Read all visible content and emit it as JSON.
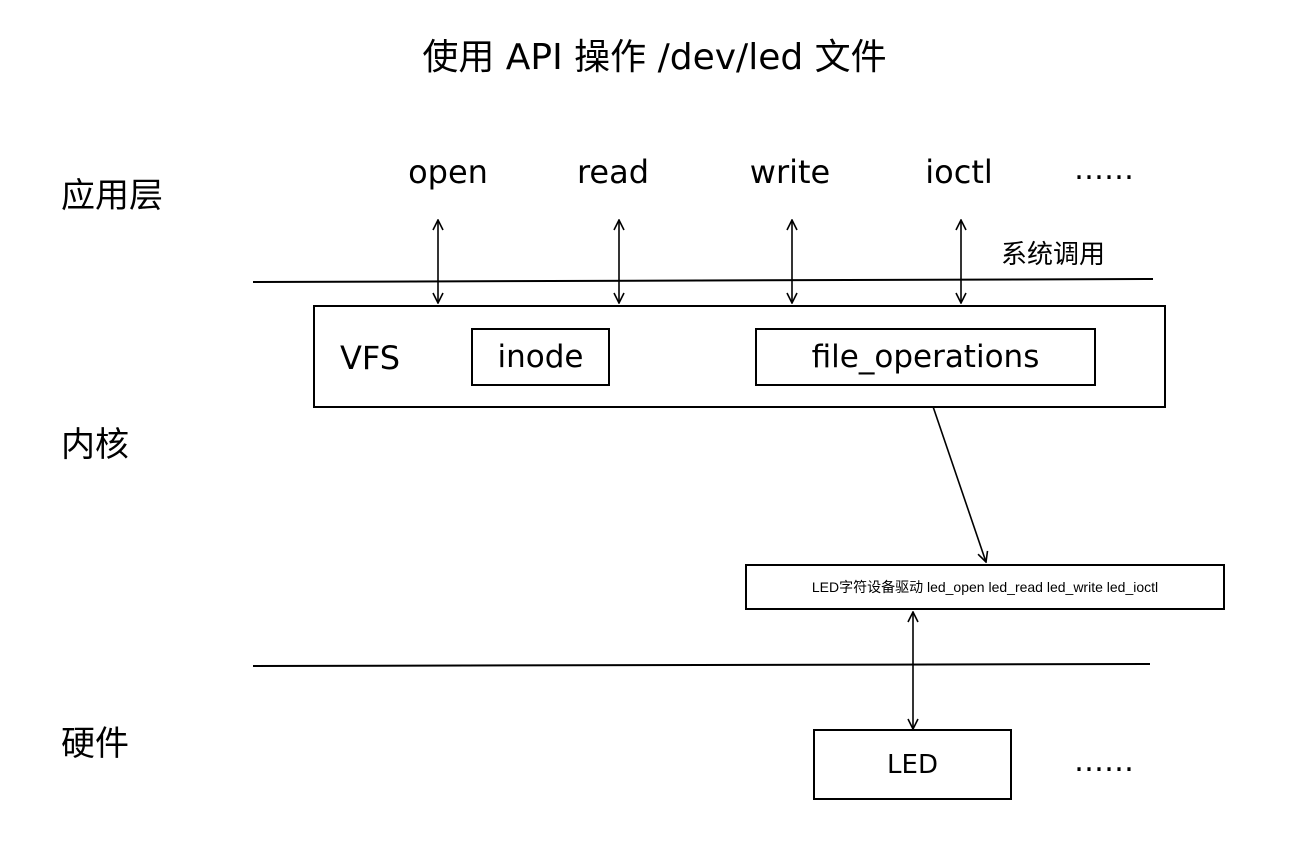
{
  "title": "使用  API 操作 /dev/led 文件",
  "layers": {
    "app": "应用层",
    "kernel": "内核",
    "hardware": "硬件"
  },
  "syscalls": {
    "items": [
      "open",
      "read",
      "write",
      "ioctl"
    ],
    "more": "……",
    "label": "系统调用"
  },
  "vfs": {
    "label": "VFS",
    "inode": "inode",
    "file_operations": "file_operations"
  },
  "driver": {
    "label": "LED字符设备驱动 led_open  led_read  led_write  led_ioctl"
  },
  "hardware_devices": {
    "led": "LED",
    "more": "……"
  }
}
